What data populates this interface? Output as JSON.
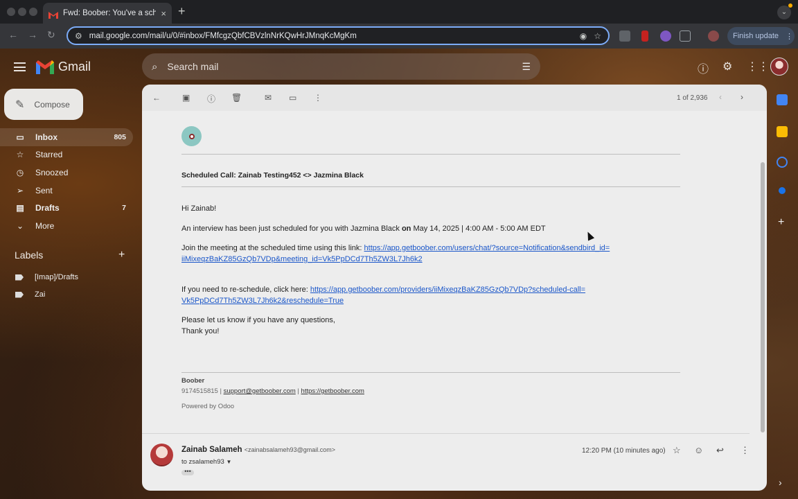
{
  "browser": {
    "tab_title": "Fwd: Boober: You've a schedu",
    "url": "mail.google.com/mail/u/0/#inbox/FMfcgzQbfCBVzlnNrKQwHrJMnqKcMgKm",
    "finish_update_label": "Finish update",
    "new_tab_symbol": "+",
    "tab_close_symbol": "×"
  },
  "gmail": {
    "brand": "Gmail",
    "search_placeholder": "Search mail",
    "compose_label": "Compose",
    "nav": [
      {
        "label": "Inbox",
        "count": "805",
        "icon": "inbox-icon",
        "glyph": "▭"
      },
      {
        "label": "Starred",
        "count": "",
        "icon": "star-icon",
        "glyph": "☆"
      },
      {
        "label": "Snoozed",
        "count": "",
        "icon": "clock-icon",
        "glyph": "◷"
      },
      {
        "label": "Sent",
        "count": "",
        "icon": "send-icon",
        "glyph": "➢"
      },
      {
        "label": "Drafts",
        "count": "7",
        "icon": "draft-icon",
        "glyph": "▤"
      },
      {
        "label": "More",
        "count": "",
        "icon": "chevron-down-icon",
        "glyph": "⌄"
      }
    ],
    "labels_heading": "Labels",
    "labels": [
      {
        "label": "[Imap]/Drafts"
      },
      {
        "label": "Zai"
      }
    ]
  },
  "message": {
    "page_count": "1 of 2,936",
    "subject_line": "Scheduled Call: Zainab Testing452 <> Jazmina Black",
    "greeting": "Hi Zainab!",
    "interview_pre": "An interview has been just scheduled for you with Jazmina Black ",
    "interview_on": "on",
    "interview_post": " May 14, 2025 | 4:00 AM - 5:00 AM EDT",
    "join_text": "Join the meeting at the scheduled time using this link: ",
    "join_link_1": "https://app.getboober.com/users/chat/?source=Notification&sendbird_id=",
    "join_link_2": "iiMixeqzBaKZ85GzQb7VDp&meeting_id=Vk5PpDCd7Th5ZW3L7Jh6k2",
    "resched_text": "If you need to re-schedule, click here: ",
    "resched_link_1": "https://app.getboober.com/providers/iiMixeqzBaKZ85GzQb7VDp?scheduled-call=",
    "resched_link_2": "Vk5PpDCd7Th5ZW3L7Jh6k2&reschedule=True",
    "closing_1": "Please let us know if you have any questions,",
    "closing_2": "Thank you!",
    "footer_company": "Boober",
    "footer_phone": "9174515815",
    "footer_sep": "|",
    "footer_email": "support@getboober.com",
    "footer_site": "https://getboober.com",
    "powered_by": "Powered by Odoo"
  },
  "reply": {
    "sender_name": "Zainab Salameh",
    "sender_email": "<zainabsalameh93@gmail.com>",
    "to": "to zsalameh93",
    "time": "12:20 PM (10 minutes ago)",
    "ellipsis": "•••"
  },
  "colors": {
    "accent": "#7cacf8",
    "link": "#1a56c9",
    "gmail_red": "#ea4335"
  }
}
